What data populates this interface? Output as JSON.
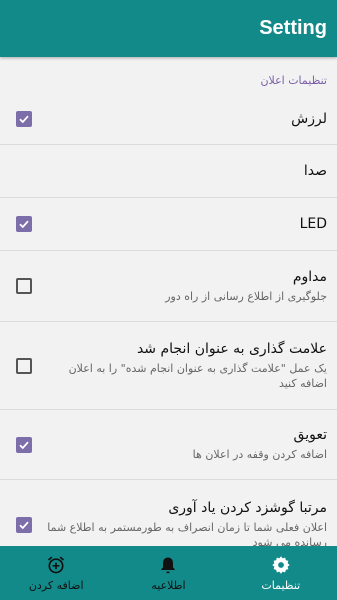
{
  "appbar": {
    "title": "Setting"
  },
  "section": {
    "header": "تنظیمات اعلان"
  },
  "settings": [
    {
      "title": "لرزش",
      "summary": "",
      "checked": true
    },
    {
      "title": "صدا",
      "summary": "",
      "checked": null
    },
    {
      "title": "LED",
      "summary": "",
      "checked": true
    },
    {
      "title": "مداوم",
      "summary": "جلوگیری از اطلاع رسانی از راه دور",
      "checked": false
    },
    {
      "title": "علامت گذاری به عنوان انجام شد",
      "summary": "یک عمل \"علامت گذاری به عنوان انجام شده\" را به اعلان اضافه کنید",
      "checked": false
    },
    {
      "title": "تعویق",
      "summary": "اضافه کردن وقفه در اعلان ها",
      "checked": true
    },
    {
      "title": "مرتبا گوشزد کردن یاد آوری",
      "summary": "اعلان فعلی شما تا زمان انصراف به طورمستمر به اطلاع شما رسانده می شود",
      "checked": true
    }
  ],
  "bottom_nav": {
    "items": [
      {
        "label": "اضافه کردن",
        "icon": "alarm-add-icon"
      },
      {
        "label": "اطلاعیه",
        "icon": "bell-icon"
      },
      {
        "label": "تنظیمات",
        "icon": "gear-icon",
        "active": true
      }
    ]
  },
  "colors": {
    "primary": "#138a8a",
    "accent": "#7c6ea8"
  }
}
